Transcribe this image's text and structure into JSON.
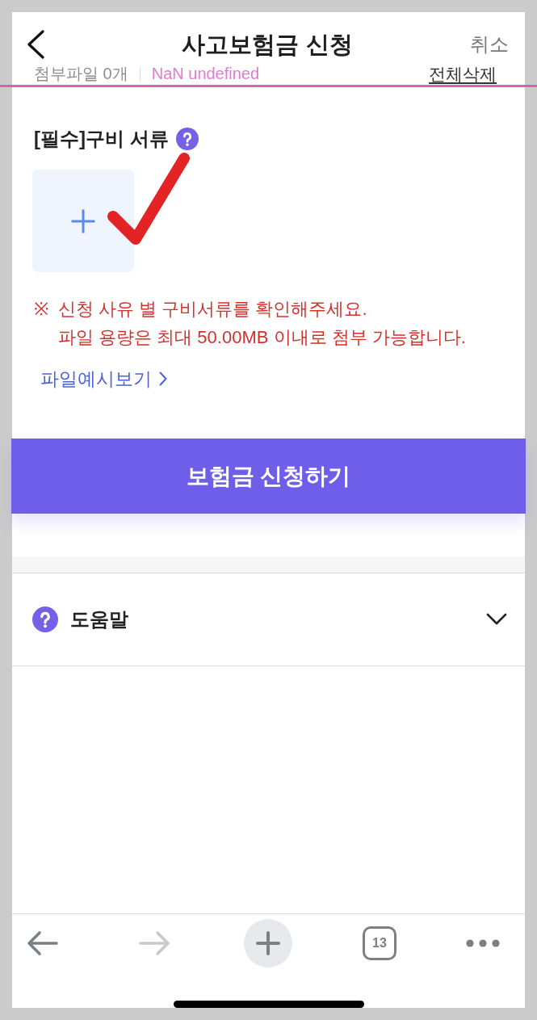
{
  "header": {
    "title": "사고보험금 신청",
    "cancel": "취소"
  },
  "attachments": {
    "count": "첨부파일 0개",
    "size": "NaN undefined",
    "delete_all": "전체삭제"
  },
  "documents": {
    "title": "[필수]구비 서류",
    "notice": {
      "mark": "※",
      "lines": [
        "신청 사유 별 구비서류를 확인해주세요.",
        "파일 용량은 최대 50.00MB 이내로 첨부 가능합니다."
      ]
    },
    "example_link": "파일예시보기"
  },
  "submit_button": "보험금 신청하기",
  "help": {
    "label": "도움말",
    "expanded": false
  },
  "toolbar": {
    "items": [
      {
        "kind": "back",
        "disabled": false
      },
      {
        "kind": "forward",
        "disabled": true
      },
      {
        "kind": "add",
        "disabled": false
      },
      {
        "kind": "tabs",
        "count": "13",
        "disabled": false
      },
      {
        "kind": "more",
        "disabled": false
      }
    ]
  }
}
